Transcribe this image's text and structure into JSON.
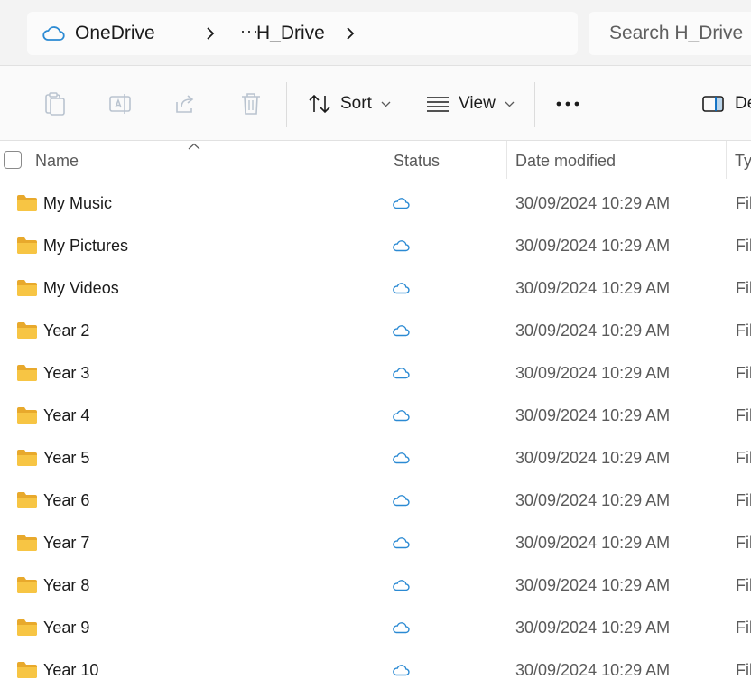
{
  "address_bar": {
    "root_label": "OneDrive",
    "overflow_label": "···",
    "current_folder": "H_Drive",
    "search_placeholder": "Search H_Drive"
  },
  "toolbar": {
    "sort_label": "Sort",
    "view_label": "View",
    "more_label": "•••",
    "details_label": "De",
    "disabled_icons": [
      "copy-icon",
      "rename-icon",
      "share-icon",
      "delete-icon"
    ]
  },
  "columns": {
    "name": "Name",
    "status": "Status",
    "date_modified": "Date modified",
    "type": "Ty"
  },
  "colors": {
    "folder": "#f7c544",
    "cloud_status": "#2b8ad3",
    "accent": "#0067c0"
  },
  "rows": [
    {
      "name": "My Music",
      "status_icon": "cloud-icon",
      "date": "30/09/2024 10:29 AM",
      "type": "Fil"
    },
    {
      "name": "My Pictures",
      "status_icon": "cloud-icon",
      "date": "30/09/2024 10:29 AM",
      "type": "Fil"
    },
    {
      "name": "My Videos",
      "status_icon": "cloud-icon",
      "date": "30/09/2024 10:29 AM",
      "type": "Fil"
    },
    {
      "name": "Year 2",
      "status_icon": "cloud-icon",
      "date": "30/09/2024 10:29 AM",
      "type": "Fil"
    },
    {
      "name": "Year 3",
      "status_icon": "cloud-icon",
      "date": "30/09/2024 10:29 AM",
      "type": "Fil"
    },
    {
      "name": "Year 4",
      "status_icon": "cloud-icon",
      "date": "30/09/2024 10:29 AM",
      "type": "Fil"
    },
    {
      "name": "Year 5",
      "status_icon": "cloud-icon",
      "date": "30/09/2024 10:29 AM",
      "type": "Fil"
    },
    {
      "name": "Year 6",
      "status_icon": "cloud-icon",
      "date": "30/09/2024 10:29 AM",
      "type": "Fil"
    },
    {
      "name": "Year 7",
      "status_icon": "cloud-icon",
      "date": "30/09/2024 10:29 AM",
      "type": "Fil"
    },
    {
      "name": "Year 8",
      "status_icon": "cloud-icon",
      "date": "30/09/2024 10:29 AM",
      "type": "Fil"
    },
    {
      "name": "Year 9",
      "status_icon": "cloud-icon",
      "date": "30/09/2024 10:29 AM",
      "type": "Fil"
    },
    {
      "name": "Year 10",
      "status_icon": "cloud-icon",
      "date": "30/09/2024 10:29 AM",
      "type": "Fil"
    }
  ]
}
